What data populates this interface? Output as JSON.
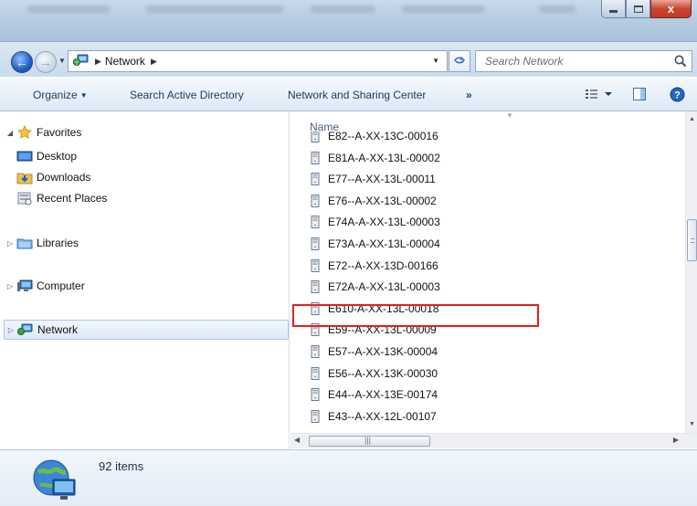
{
  "window": {
    "minimize_icon": "minimize-icon",
    "maximize_icon": "maximize-icon",
    "close_label": "x"
  },
  "address_bar": {
    "location_icon": "network-icon",
    "breadcrumb": "Network",
    "search_placeholder": "Search Network",
    "refresh_icon": "refresh-icon",
    "search_icon": "magnifier-icon"
  },
  "toolbar": {
    "organize_label": "Organize",
    "search_ad_label": "Search Active Directory",
    "network_sharing_label": "Network and Sharing Center",
    "more_label": "»",
    "view_icon": "view-options-icon",
    "preview_icon": "preview-pane-icon",
    "help_icon": "help-icon"
  },
  "nav_pane": {
    "favorites": {
      "label": "Favorites",
      "icon": "star-icon"
    },
    "favorites_items": [
      {
        "label": "Desktop",
        "icon": "desktop-icon"
      },
      {
        "label": "Downloads",
        "icon": "downloads-folder-icon"
      },
      {
        "label": "Recent Places",
        "icon": "recent-places-icon"
      }
    ],
    "libraries": {
      "label": "Libraries",
      "icon": "libraries-icon"
    },
    "computer": {
      "label": "Computer",
      "icon": "computer-icon"
    },
    "network": {
      "label": "Network",
      "icon": "network-icon"
    }
  },
  "file_list": {
    "column_header": "Name",
    "items": [
      {
        "name": "E82--A-XX-13C-00016"
      },
      {
        "name": "E81A-A-XX-13L-00002"
      },
      {
        "name": "E77--A-XX-13L-00011"
      },
      {
        "name": "E76--A-XX-13L-00002"
      },
      {
        "name": "E74A-A-XX-13L-00003"
      },
      {
        "name": "E73A-A-XX-13L-00004"
      },
      {
        "name": "E72--A-XX-13D-00166"
      },
      {
        "name": "E72A-A-XX-13L-00003"
      },
      {
        "name": "E610-A-XX-13L-00018",
        "highlighted": true
      },
      {
        "name": "E59--A-XX-13L-00009"
      },
      {
        "name": "E57--A-XX-13K-00004"
      },
      {
        "name": "E56--A-XX-13K-00030"
      },
      {
        "name": "E44--A-XX-13E-00174"
      },
      {
        "name": "E43--A-XX-12L-00107"
      }
    ],
    "item_icon": "computer-tower-icon",
    "highlight_color": "#e02020"
  },
  "details": {
    "count_label": "92 items",
    "icon": "network-globe-icon"
  },
  "colors": {
    "accent": "#1e395b",
    "title_gradient_top": "#c9daea",
    "close_red": "#c8452f"
  }
}
